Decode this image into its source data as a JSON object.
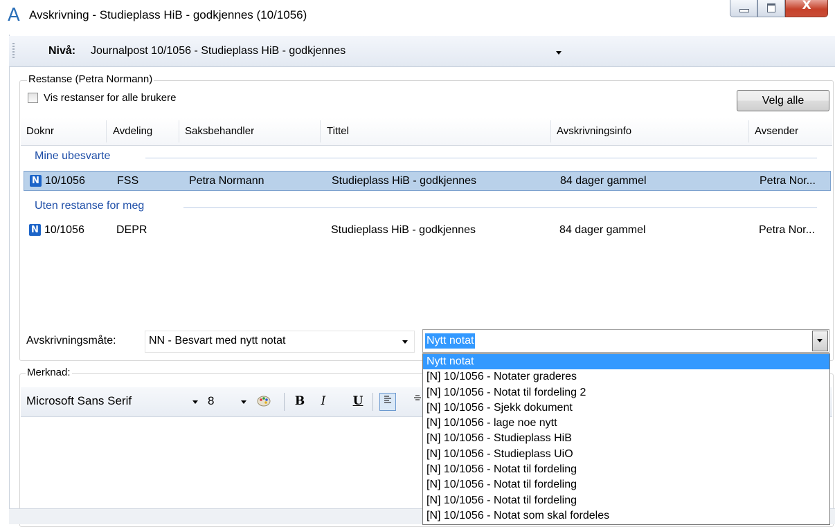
{
  "window": {
    "title": "Avskrivning - Studieplass HiB - godkjennes (10/1056)",
    "app_icon": "A",
    "close_glyph": "X"
  },
  "toolbar": {
    "level_label": "Nivå:",
    "level_value": "Journalpost 10/1056 - Studieplass HiB - godkjennes"
  },
  "restanse": {
    "group_title": "Restanse (Petra Normann)",
    "checkbox_label": "Vis restanser for alle brukere",
    "checkbox_checked": false,
    "select_all_button": "Velg alle",
    "columns": [
      "Doknr",
      "Avdeling",
      "Saksbehandler",
      "Tittel",
      "Avskrivningsinfo",
      "Avsender"
    ],
    "groups": [
      {
        "heading": "Mine ubesvarte",
        "rows": [
          {
            "badge": "N",
            "doknr": "10/1056",
            "avdeling": "FSS",
            "saksbehandler": "Petra Normann",
            "tittel": "Studieplass HiB - godkjennes",
            "info": "84 dager gammel",
            "avsender": "Petra Nor...",
            "selected": true
          }
        ]
      },
      {
        "heading": "Uten restanse for meg",
        "rows": [
          {
            "badge": "N",
            "doknr": "10/1056",
            "avdeling": "DEPR",
            "saksbehandler": "",
            "tittel": "Studieplass HiB - godkjennes",
            "info": "84 dager gammel",
            "avsender": "Petra Nor...",
            "selected": false
          }
        ]
      }
    ]
  },
  "avskrivning": {
    "label": "Avskrivningsmåte:",
    "method_value": "NN - Besvart med nytt notat",
    "note_value": "Nytt notat",
    "options": [
      "Nytt notat",
      "[N] 10/1056 - Notater graderes",
      "[N] 10/1056 - Notat til fordeling 2",
      "[N] 10/1056 - Sjekk dokument",
      "[N] 10/1056 - lage noe nytt",
      "[N] 10/1056 - Studieplass HiB",
      "[N] 10/1056 - Studieplass UiO",
      "[N] 10/1056 - Notat til fordeling",
      "[N] 10/1056 - Notat til fordeling",
      "[N] 10/1056 - Notat til fordeling",
      "[N] 10/1056 - Notat som skal fordeles"
    ],
    "highlighted_option": "Nytt notat"
  },
  "merknad": {
    "title": "Merknad:",
    "font_name": "Microsoft Sans Serif",
    "font_size": "8",
    "bold_label": "B",
    "italic_label": "I",
    "underline_label": "U"
  }
}
